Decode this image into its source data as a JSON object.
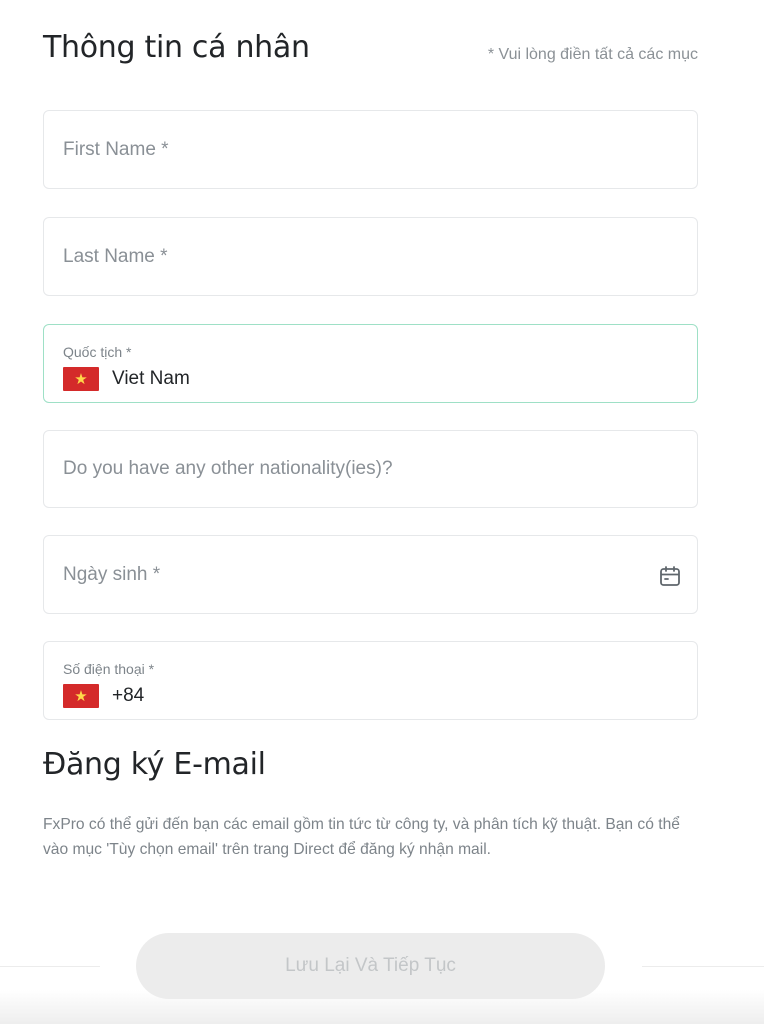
{
  "personal_info": {
    "title": "Thông tin cá nhân",
    "required_note": "* Vui lòng điền tất cả các mục"
  },
  "fields": {
    "first_name": {
      "placeholder": "First Name *"
    },
    "last_name": {
      "placeholder": "Last Name *"
    },
    "nationality": {
      "label": "Quốc tịch *",
      "value": "Viet Nam",
      "flag_icon": "vietnam-flag-icon"
    },
    "other_nationality": {
      "placeholder": "Do you have any other nationality(ies)?"
    },
    "birth_date": {
      "placeholder": "Ngày sinh *",
      "icon": "calendar-icon"
    },
    "phone": {
      "label": "Số điện thoại *",
      "value": "+84",
      "flag_icon": "vietnam-flag-icon"
    }
  },
  "email_section": {
    "title": "Đăng ký E-mail",
    "description": "FxPro có thể gửi đến bạn các email gồm tin tức từ công ty, và phân tích kỹ thuật. Bạn có thể vào mục 'Tùy chọn email' trên trang Direct để đăng ký nhận mail."
  },
  "footer": {
    "save_label": "Lưu Lại Và Tiếp Tục"
  },
  "colors": {
    "active_border": "#9ee0c6",
    "flag_red": "#d42a2a",
    "flag_star": "#ffd84a",
    "button_bg": "#ececec",
    "button_text": "#c3c6c8"
  }
}
